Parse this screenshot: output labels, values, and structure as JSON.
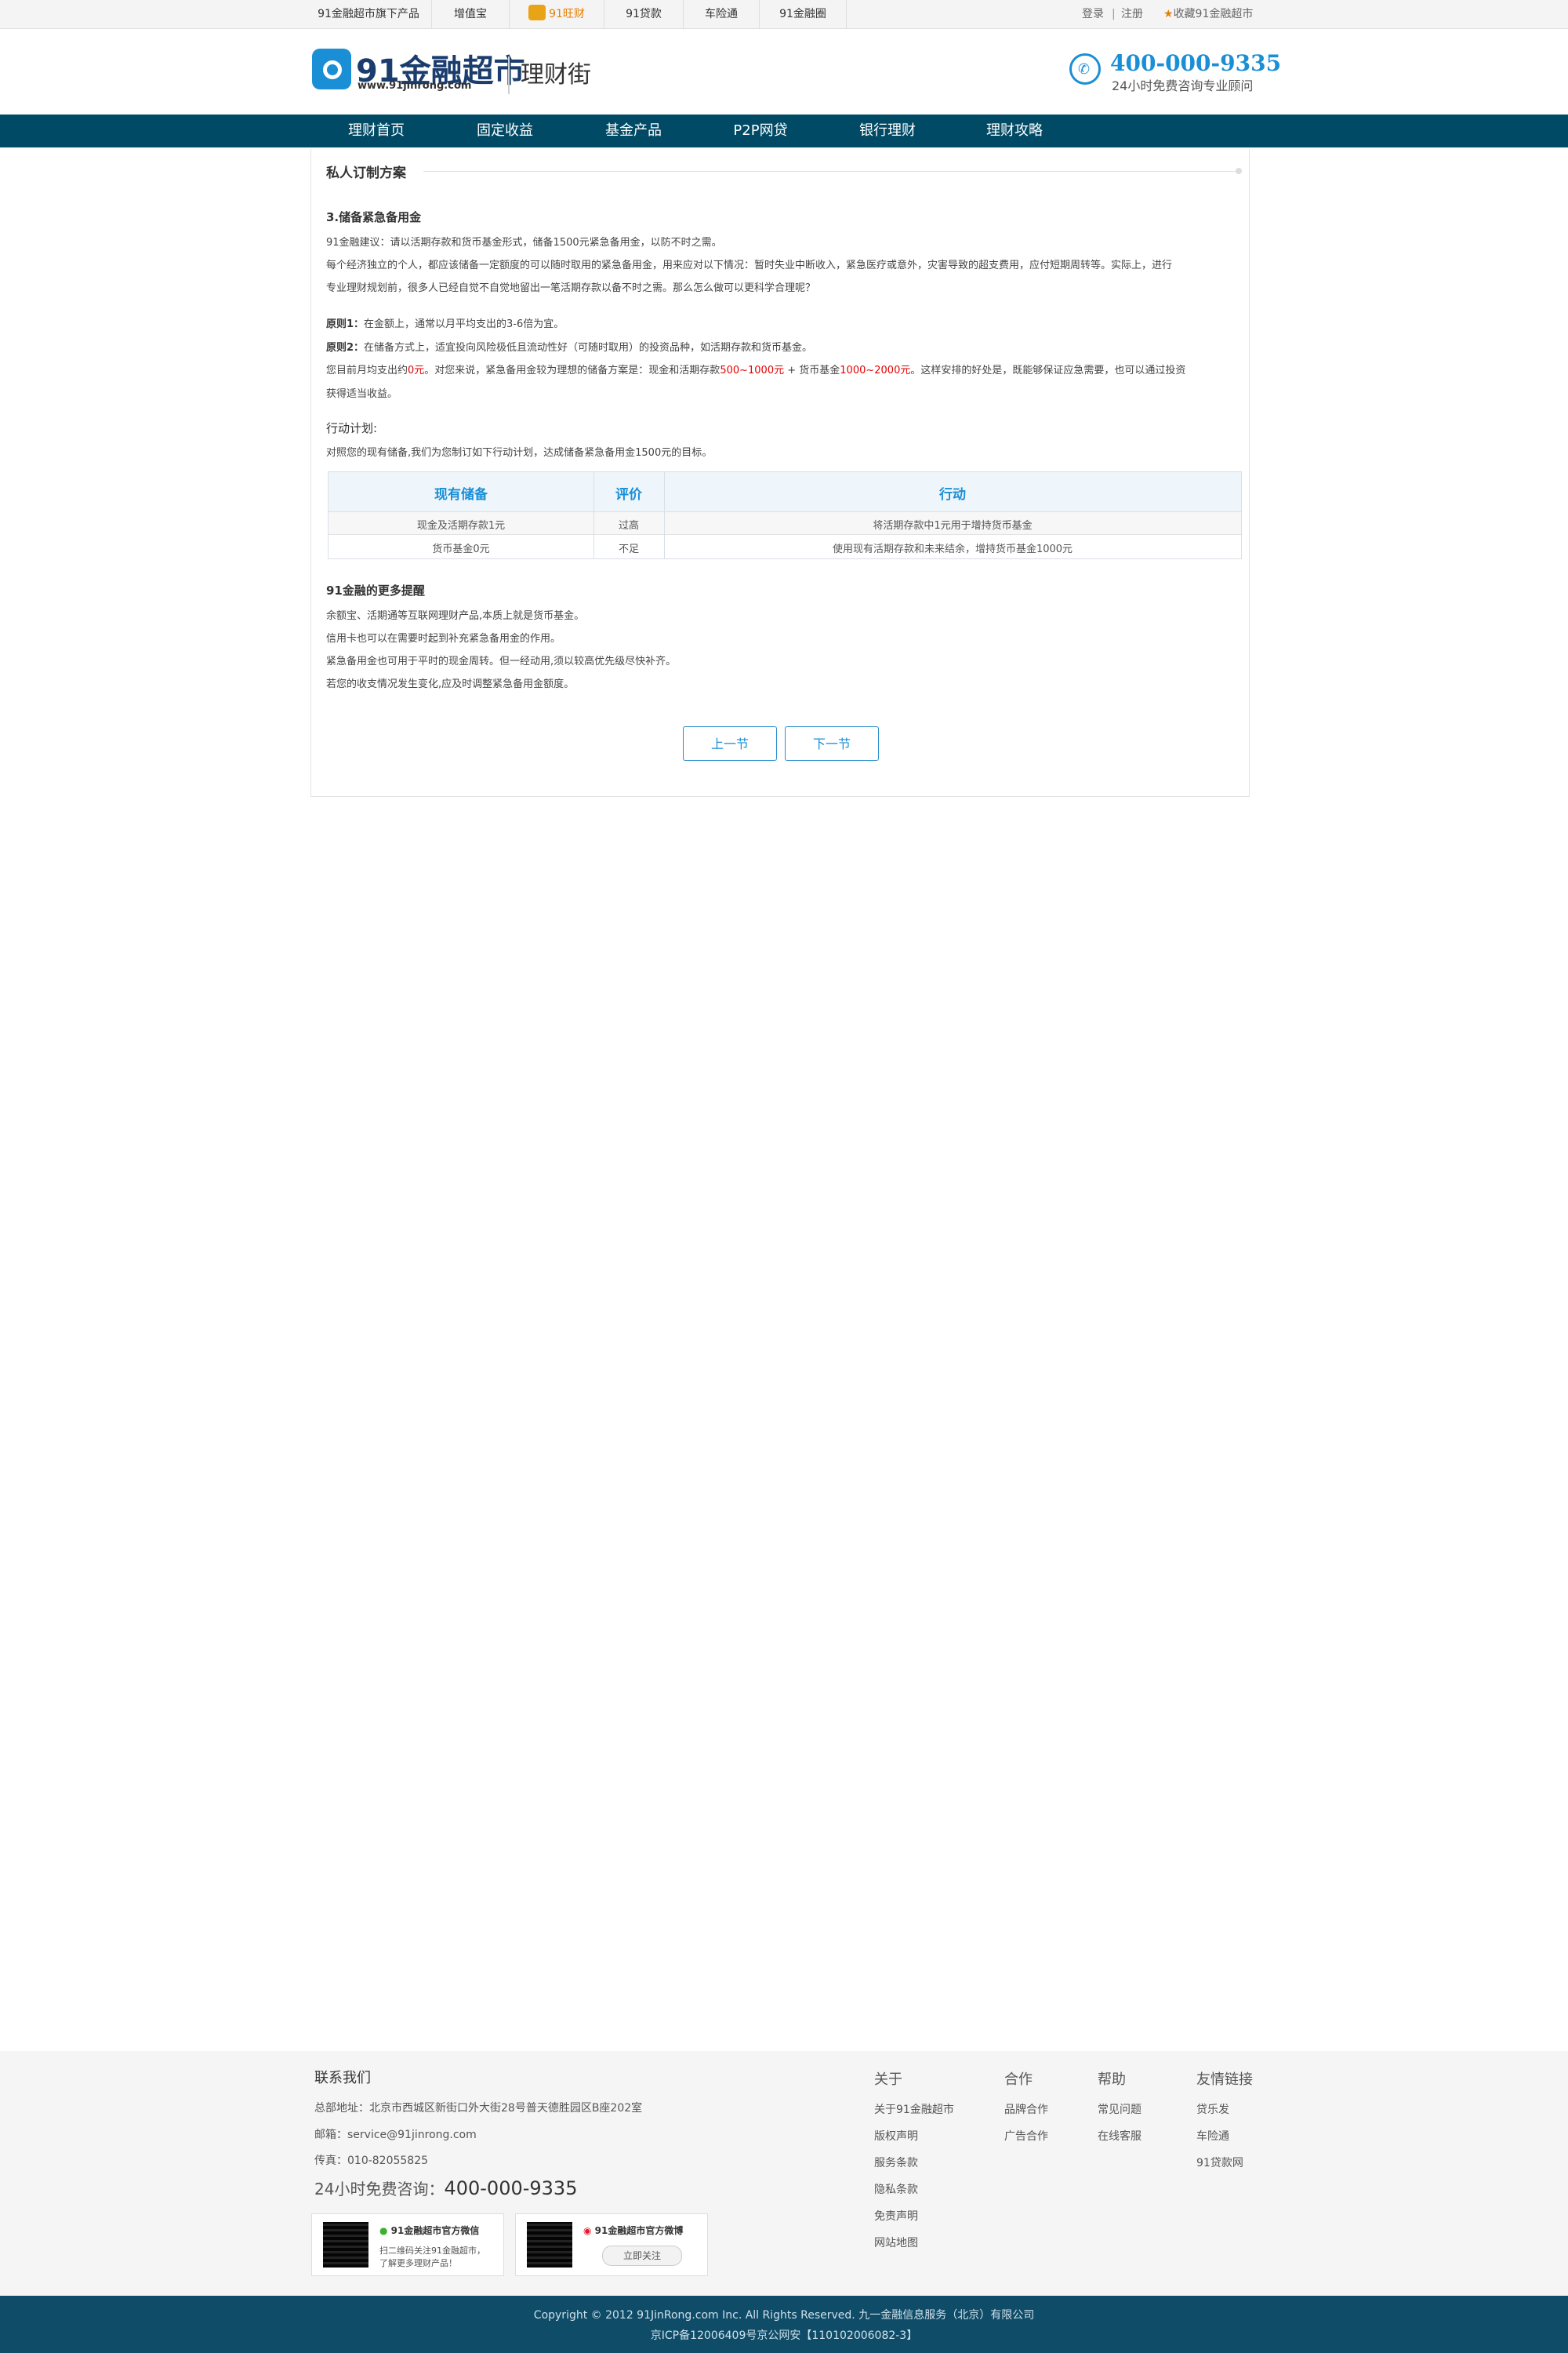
{
  "topbar": {
    "products_label": "91金融超市旗下产品",
    "items": [
      "增值宝",
      "91旺财",
      "91贷款",
      "车险通",
      "91金融圈"
    ],
    "login": "登录",
    "register": "注册",
    "favorite": "收藏91金融超市"
  },
  "header": {
    "logo_text": "91金融超市",
    "logo_url": "www.91jinrong.com",
    "section_title": "理财街",
    "phone": "400-000-9335",
    "phone_caption": "24小时免费咨询专业顾问"
  },
  "nav": {
    "items": [
      "理财首页",
      "固定收益",
      "基金产品",
      "P2P网贷",
      "银行理财",
      "理财攻略"
    ]
  },
  "content": {
    "panel_title": "私人订制方案",
    "section_heading": "3.储备紧急备用金",
    "advice": "91金融建议：请以活期存款和货币基金形式，储备1500元紧急备用金，以防不时之需。",
    "intro_line1": "每个经济独立的个人，都应该储备一定额度的可以随时取用的紧急备用金，用来应对以下情况：暂时失业中断收入，紧急医疗或意外，灾害导致的超支费用，应付短期周转等。实际上，进行",
    "intro_line2": "专业理财规划前，很多人已经自觉不自觉地留出一笔活期存款以备不时之需。那么怎么做可以更科学合理呢？",
    "principle1_label": "原则1：",
    "principle1_text": "在金额上，通常以月平均支出的3-6倍为宜。",
    "principle2_label": "原则2：",
    "principle2_text": "在储备方式上，适宜投向风险极低且流动性好（可随时取用）的投资品种，如活期存款和货币基金。",
    "expense_prefix": "您目前月均支出约",
    "expense_amount": "0元",
    "expense_mid": "。对您来说，紧急备用金较为理想的储备方案是：现金和活期存款",
    "deposit_range": "500~1000元",
    "plus_fund": " + 货币基金",
    "fund_range": "1000~2000元",
    "expense_suffix": "。这样安排的好处是，既能够保证应急需要，也可以通过投资",
    "expense_line2": "获得适当收益。",
    "action_heading": "行动计划:",
    "action_intro": "对照您的现有储备,我们为您制订如下行动计划，达成储备紧急备用金1500元的目标。",
    "table": {
      "headers": [
        "现有储备",
        "评价",
        "行动"
      ],
      "rows": [
        [
          "现金及活期存款1元",
          "过高",
          "将活期存款中1元用于增持货币基金"
        ],
        [
          "货币基金0元",
          "不足",
          "使用现有活期存款和未来结余，增持货币基金1000元"
        ]
      ]
    },
    "tips_heading": "91金融的更多提醒",
    "tips": [
      "余额宝、活期通等互联网理财产品,本质上就是货币基金。",
      "信用卡也可以在需要时起到补充紧急备用金的作用。",
      "紧急备用金也可用于平时的现金周转。但一经动用,须以较高优先级尽快补齐。",
      "若您的收支情况发生变化,应及时调整紧急备用金额度。"
    ],
    "prev_button": "上一节",
    "next_button": "下一节"
  },
  "footer": {
    "contact_heading": "联系我们",
    "address": "总部地址：北京市西城区新街口外大街28号普天德胜园区B座202室",
    "email": "邮箱：service@91jinrong.com",
    "fax": "传真：010-82055825",
    "hotline_label": "24小时免费咨询：",
    "hotline_number": "400-000-9335",
    "wechat_title": "91金融超市官方微信",
    "wechat_desc_line1": "扫二维码关注91金融超市，",
    "wechat_desc_line2": "了解更多理财产品！",
    "weibo_title": "91金融超市官方微博",
    "weibo_follow": "立即关注",
    "columns": [
      {
        "heading": "关于",
        "links": [
          "关于91金融超市",
          "版权声明",
          "服务条款",
          "隐私条款",
          "免责声明",
          "网站地图"
        ]
      },
      {
        "heading": "合作",
        "links": [
          "品牌合作",
          "广告合作"
        ]
      },
      {
        "heading": "帮助",
        "links": [
          "常见问题",
          "在线客服"
        ]
      },
      {
        "heading": "友情链接",
        "links": [
          "贷乐发",
          "车险通",
          "91贷款网"
        ]
      }
    ],
    "copyright_line1": "Copyright © 2012 91JinRong.com Inc. All Rights Reserved. 九一金融信息服务（北京）有限公司",
    "copyright_line2": "京ICP备12006409号京公网安【110102006082-3】"
  },
  "colors": {
    "nav_bg": "#004a66",
    "brand_blue": "#1a8fd6",
    "highlight_red": "#e60000",
    "footer_bottom_bg": "#0f4c68"
  }
}
